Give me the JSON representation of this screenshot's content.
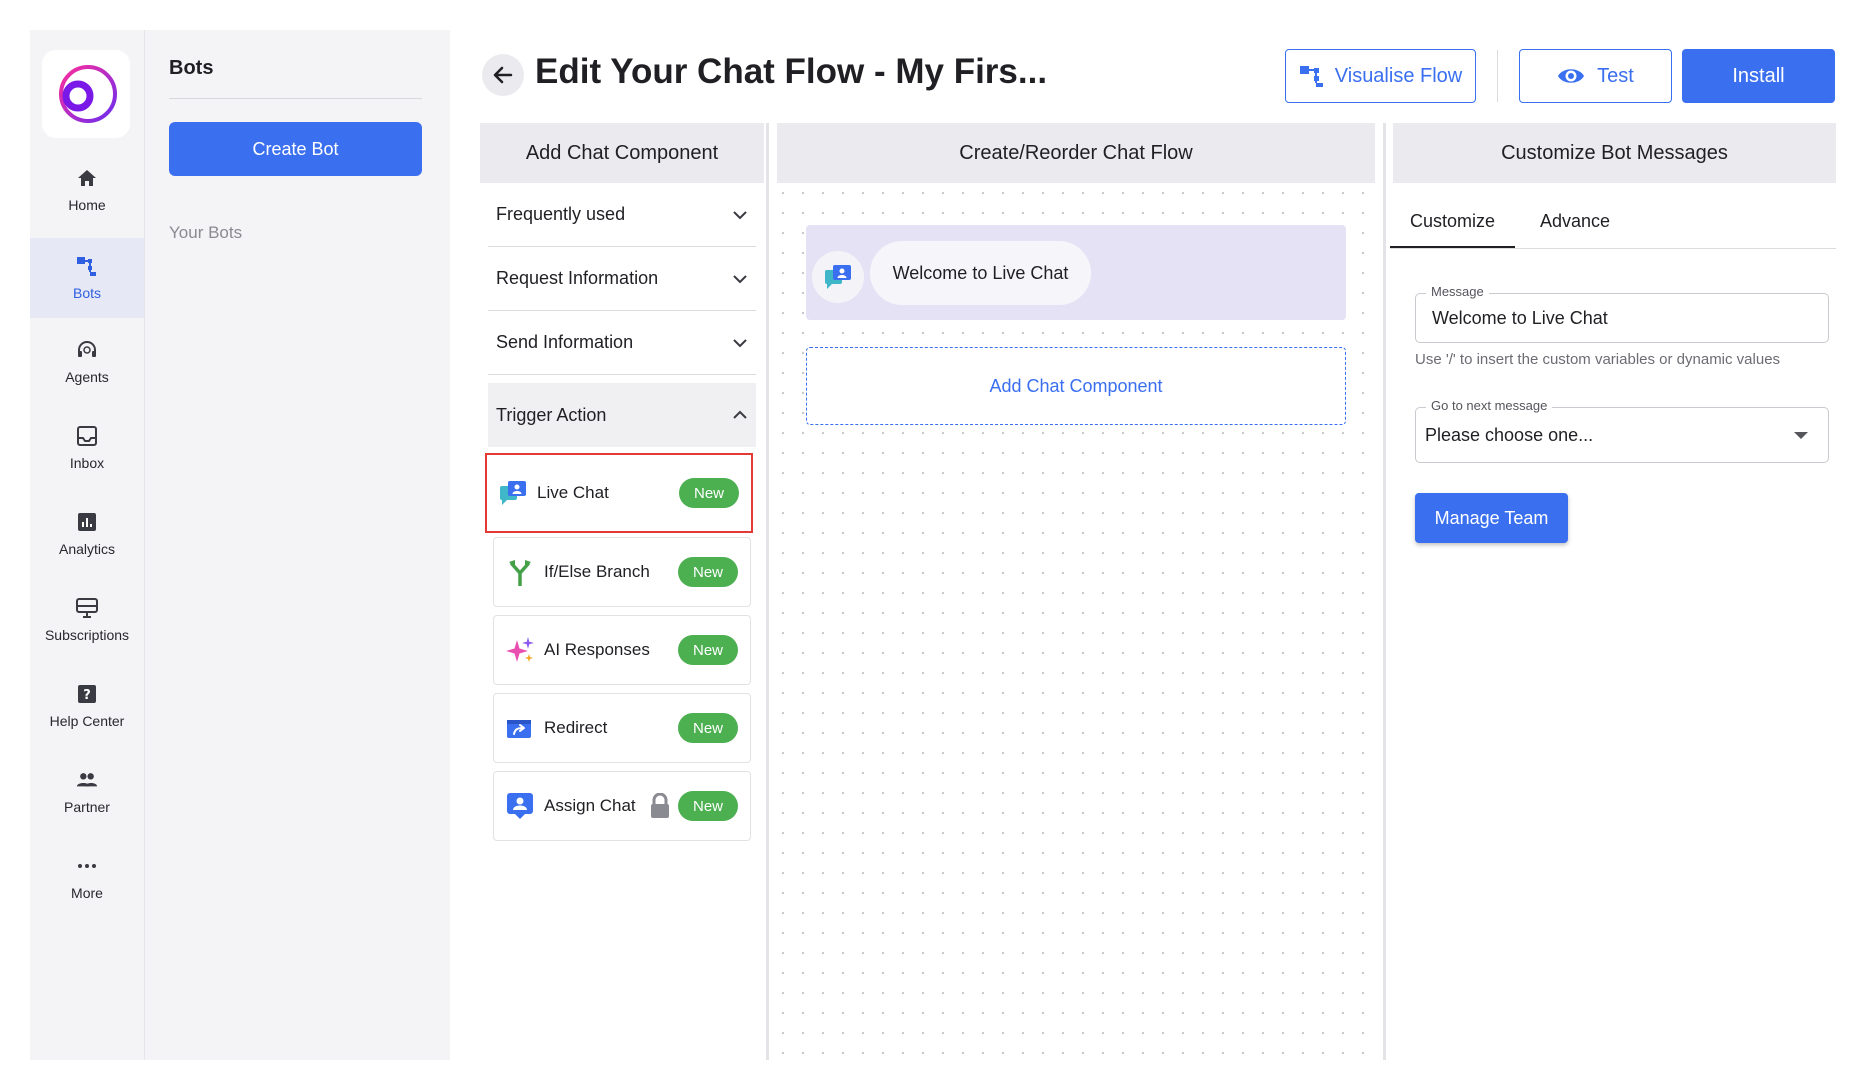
{
  "colors": {
    "primary": "#3a6ff0",
    "badge_new": "#4caf50",
    "highlight_border": "#e53935"
  },
  "sidebar": {
    "logo_icon": "app-logo",
    "items": [
      {
        "label": "Home",
        "icon": "home-icon",
        "active": false
      },
      {
        "label": "Bots",
        "icon": "bots-icon",
        "active": true
      },
      {
        "label": "Agents",
        "icon": "headset-icon",
        "active": false
      },
      {
        "label": "Inbox",
        "icon": "inbox-icon",
        "active": false
      },
      {
        "label": "Analytics",
        "icon": "analytics-icon",
        "active": false
      },
      {
        "label": "Subscriptions",
        "icon": "subscriptions-icon",
        "active": false
      },
      {
        "label": "Help Center",
        "icon": "help-icon",
        "active": false
      },
      {
        "label": "Partner",
        "icon": "people-icon",
        "active": false
      },
      {
        "label": "More",
        "icon": "more-icon",
        "active": false
      }
    ]
  },
  "bots_panel": {
    "title": "Bots",
    "create_button": "Create Bot",
    "your_bots_label": "Your Bots"
  },
  "header": {
    "title": "Edit Your Chat Flow - My Firs...",
    "visualise_button": "Visualise Flow",
    "test_button": "Test",
    "install_button": "Install"
  },
  "columns": {
    "components": "Add Chat Component",
    "flow": "Create/Reorder Chat Flow",
    "customize": "Customize Bot Messages"
  },
  "components": {
    "sections": [
      {
        "label": "Frequently used",
        "expanded": false
      },
      {
        "label": "Request Information",
        "expanded": false
      },
      {
        "label": "Send Information",
        "expanded": false
      },
      {
        "label": "Trigger Action",
        "expanded": true
      }
    ],
    "trigger_items": [
      {
        "label": "Live Chat",
        "badge": "New",
        "icon": "live-chat-icon",
        "locked": false,
        "highlighted": true
      },
      {
        "label": "If/Else Branch",
        "badge": "New",
        "icon": "branch-icon",
        "locked": false,
        "highlighted": false
      },
      {
        "label": "AI Responses",
        "badge": "New",
        "icon": "sparkle-icon",
        "locked": false,
        "highlighted": false
      },
      {
        "label": "Redirect",
        "badge": "New",
        "icon": "redirect-icon",
        "locked": false,
        "highlighted": false
      },
      {
        "label": "Assign Chat",
        "badge": "New",
        "icon": "assign-chat-icon",
        "locked": true,
        "highlighted": false
      }
    ]
  },
  "flow": {
    "node_message": "Welcome to Live Chat",
    "add_component_label": "Add Chat Component"
  },
  "customize": {
    "tabs": [
      {
        "label": "Customize",
        "active": true
      },
      {
        "label": "Advance",
        "active": false
      }
    ],
    "message_legend": "Message",
    "message_value": "Welcome to Live Chat",
    "hint": "Use '/' to insert the custom variables or dynamic values",
    "next_legend": "Go to next message",
    "next_value": "Please choose one...",
    "manage_team_button": "Manage Team"
  }
}
